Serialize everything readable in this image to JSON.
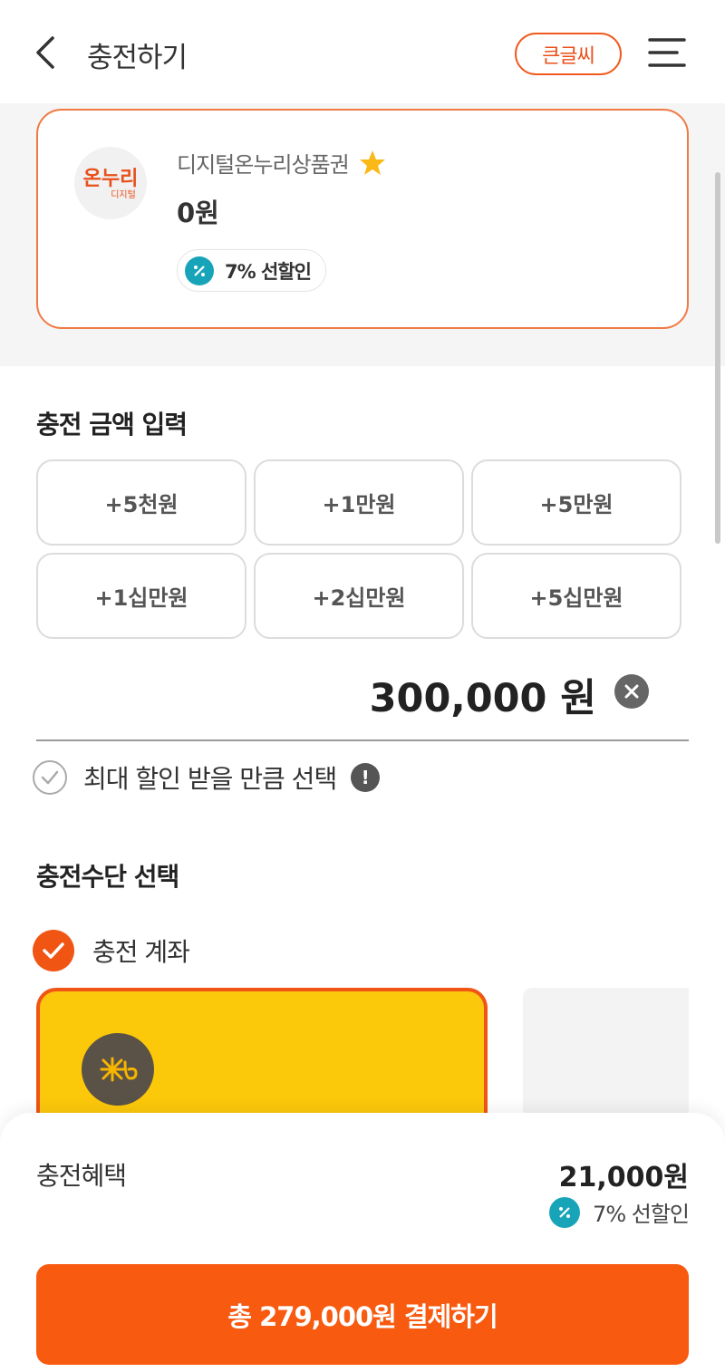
{
  "header": {
    "title": "충전하기",
    "bigfont_label": "큰글씨"
  },
  "voucher": {
    "logo_text": "온누리",
    "logo_sub": "디지털",
    "name": "디지털온누리상품권",
    "balance": "0원",
    "discount_badge": "7% 선할인"
  },
  "amount_section": {
    "title": "충전 금액 입력",
    "buttons": [
      "+5천원",
      "+1만원",
      "+5만원",
      "+1십만원",
      "+2십만원",
      "+5십만원"
    ],
    "current_value": "300,000 원",
    "max_discount_label": "최대 할인 받을 만큼 선택"
  },
  "method_section": {
    "title": "충전수단 선택",
    "option_label": "충전 계좌"
  },
  "bottom": {
    "benefit_label": "충전혜택",
    "benefit_amount": "21,000원",
    "benefit_sub": "7% 선할인",
    "pay_button": "총 279,000원 결제하기"
  },
  "colors": {
    "accent": "#f85a10",
    "discount_icon": "#17a4b8",
    "card_yellow": "#fcc80a"
  },
  "icons": {
    "back": "chevron-left-icon",
    "menu": "hamburger-menu-icon",
    "star": "star-icon",
    "percent": "percent-icon",
    "clear": "close-icon",
    "check": "check-icon",
    "info": "info-icon",
    "bank": "bank-logo-icon"
  }
}
